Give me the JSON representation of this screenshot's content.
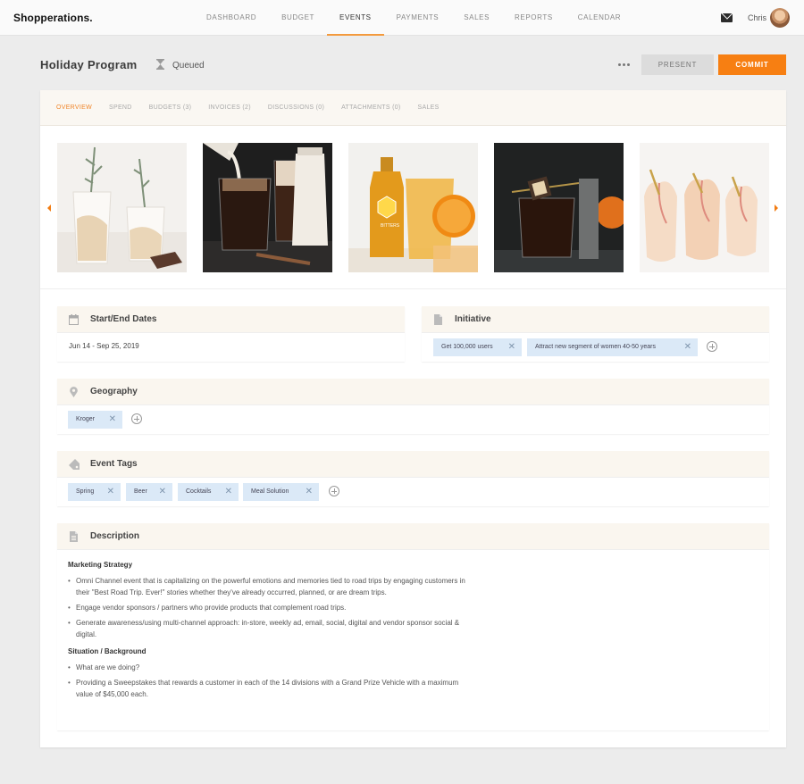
{
  "app": {
    "logo": "Shopperations."
  },
  "nav": {
    "items": [
      "DASHBOARD",
      "BUDGET",
      "EVENTS",
      "PAYMENTS",
      "SALES",
      "REPORTS",
      "CALENDAR"
    ],
    "active": "EVENTS"
  },
  "user": {
    "name": "Chris",
    "mail_icon": "mail-icon",
    "avatar_icon": "avatar"
  },
  "header": {
    "title": "Holiday Program",
    "status_icon": "hourglass-icon",
    "status": "Queued",
    "more_icon": "more-horizontal-icon",
    "present_label": "PRESENT",
    "commit_label": "COMMIT"
  },
  "colors": {
    "accent": "#f77f12",
    "chip": "#dbe9f7",
    "card_header": "#faf6ef"
  },
  "tabs": {
    "items": [
      "OVERVIEW",
      "SPEND",
      "BUDGETS (3)",
      "INVOICES (2)",
      "DISCUSSIONS (0)",
      "ATTACHMENTS (0)",
      "SALES"
    ],
    "active": "OVERVIEW"
  },
  "gallery": {
    "prev_icon": "chevron-left-icon",
    "next_icon": "chevron-right-icon",
    "images": [
      {
        "subject": "cream-drinks-with-rosemary-photo"
      },
      {
        "subject": "iced-coffee-with-milk-photo"
      },
      {
        "subject": "honey-bitters-bottle-with-orange-photo"
      },
      {
        "subject": "cocktail-with-garnish-photo"
      },
      {
        "subject": "peach-drinks-with-straws-photo"
      }
    ],
    "bitters_label": "BITTERS"
  },
  "dates": {
    "title": "Start/End Dates",
    "icon": "calendar-icon",
    "value": "Jun 14 - Sep 25, 2019"
  },
  "initiative": {
    "title": "Initiative",
    "icon": "document-icon",
    "chips": [
      "Get 100,000 users",
      "Attract new segment of women 40-50 years"
    ]
  },
  "geography": {
    "title": "Geography",
    "icon": "location-pin-icon",
    "chips": [
      "Kroger"
    ]
  },
  "event_tags": {
    "title": "Event Tags",
    "icon": "tag-icon",
    "chips": [
      "Spring",
      "Beer",
      "Cocktails",
      "Meal Solution"
    ]
  },
  "description": {
    "title": "Description",
    "icon": "document-icon",
    "sections": [
      {
        "heading": "Marketing Strategy",
        "bullets": [
          "Omni Channel event that is capitalizing on the powerful emotions and memories tied to road trips by engaging customers in their \"Best Road Trip. Ever!\" stories whether they've already occurred, planned, or are dream trips.",
          "Engage vendor sponsors / partners who provide products that complement road trips.",
          "Generate awareness/using multi-channel approach: in-store, weekly ad, email, social, digital and vendor sponsor social & digital."
        ]
      },
      {
        "heading": "Situation / Background",
        "bullets": [
          "What are we doing?",
          "Providing a Sweepstakes that rewards a customer in each of the 14 divisions with a Grand Prize Vehicle with a maximum value of $45,000 each."
        ]
      }
    ]
  }
}
